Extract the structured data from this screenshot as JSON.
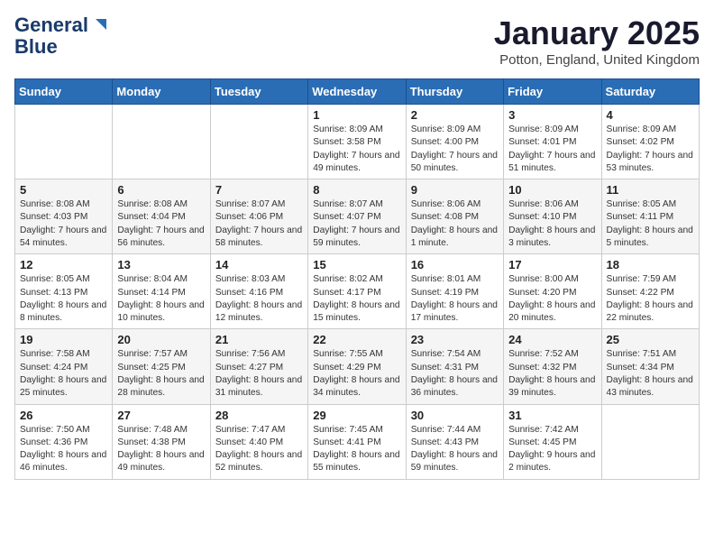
{
  "header": {
    "logo_line1": "General",
    "logo_line2": "Blue",
    "month": "January 2025",
    "location": "Potton, England, United Kingdom"
  },
  "weekdays": [
    "Sunday",
    "Monday",
    "Tuesday",
    "Wednesday",
    "Thursday",
    "Friday",
    "Saturday"
  ],
  "weeks": [
    [
      {
        "day": "",
        "sunrise": "",
        "sunset": "",
        "daylight": ""
      },
      {
        "day": "",
        "sunrise": "",
        "sunset": "",
        "daylight": ""
      },
      {
        "day": "",
        "sunrise": "",
        "sunset": "",
        "daylight": ""
      },
      {
        "day": "1",
        "sunrise": "Sunrise: 8:09 AM",
        "sunset": "Sunset: 3:58 PM",
        "daylight": "Daylight: 7 hours and 49 minutes."
      },
      {
        "day": "2",
        "sunrise": "Sunrise: 8:09 AM",
        "sunset": "Sunset: 4:00 PM",
        "daylight": "Daylight: 7 hours and 50 minutes."
      },
      {
        "day": "3",
        "sunrise": "Sunrise: 8:09 AM",
        "sunset": "Sunset: 4:01 PM",
        "daylight": "Daylight: 7 hours and 51 minutes."
      },
      {
        "day": "4",
        "sunrise": "Sunrise: 8:09 AM",
        "sunset": "Sunset: 4:02 PM",
        "daylight": "Daylight: 7 hours and 53 minutes."
      }
    ],
    [
      {
        "day": "5",
        "sunrise": "Sunrise: 8:08 AM",
        "sunset": "Sunset: 4:03 PM",
        "daylight": "Daylight: 7 hours and 54 minutes."
      },
      {
        "day": "6",
        "sunrise": "Sunrise: 8:08 AM",
        "sunset": "Sunset: 4:04 PM",
        "daylight": "Daylight: 7 hours and 56 minutes."
      },
      {
        "day": "7",
        "sunrise": "Sunrise: 8:07 AM",
        "sunset": "Sunset: 4:06 PM",
        "daylight": "Daylight: 7 hours and 58 minutes."
      },
      {
        "day": "8",
        "sunrise": "Sunrise: 8:07 AM",
        "sunset": "Sunset: 4:07 PM",
        "daylight": "Daylight: 7 hours and 59 minutes."
      },
      {
        "day": "9",
        "sunrise": "Sunrise: 8:06 AM",
        "sunset": "Sunset: 4:08 PM",
        "daylight": "Daylight: 8 hours and 1 minute."
      },
      {
        "day": "10",
        "sunrise": "Sunrise: 8:06 AM",
        "sunset": "Sunset: 4:10 PM",
        "daylight": "Daylight: 8 hours and 3 minutes."
      },
      {
        "day": "11",
        "sunrise": "Sunrise: 8:05 AM",
        "sunset": "Sunset: 4:11 PM",
        "daylight": "Daylight: 8 hours and 5 minutes."
      }
    ],
    [
      {
        "day": "12",
        "sunrise": "Sunrise: 8:05 AM",
        "sunset": "Sunset: 4:13 PM",
        "daylight": "Daylight: 8 hours and 8 minutes."
      },
      {
        "day": "13",
        "sunrise": "Sunrise: 8:04 AM",
        "sunset": "Sunset: 4:14 PM",
        "daylight": "Daylight: 8 hours and 10 minutes."
      },
      {
        "day": "14",
        "sunrise": "Sunrise: 8:03 AM",
        "sunset": "Sunset: 4:16 PM",
        "daylight": "Daylight: 8 hours and 12 minutes."
      },
      {
        "day": "15",
        "sunrise": "Sunrise: 8:02 AM",
        "sunset": "Sunset: 4:17 PM",
        "daylight": "Daylight: 8 hours and 15 minutes."
      },
      {
        "day": "16",
        "sunrise": "Sunrise: 8:01 AM",
        "sunset": "Sunset: 4:19 PM",
        "daylight": "Daylight: 8 hours and 17 minutes."
      },
      {
        "day": "17",
        "sunrise": "Sunrise: 8:00 AM",
        "sunset": "Sunset: 4:20 PM",
        "daylight": "Daylight: 8 hours and 20 minutes."
      },
      {
        "day": "18",
        "sunrise": "Sunrise: 7:59 AM",
        "sunset": "Sunset: 4:22 PM",
        "daylight": "Daylight: 8 hours and 22 minutes."
      }
    ],
    [
      {
        "day": "19",
        "sunrise": "Sunrise: 7:58 AM",
        "sunset": "Sunset: 4:24 PM",
        "daylight": "Daylight: 8 hours and 25 minutes."
      },
      {
        "day": "20",
        "sunrise": "Sunrise: 7:57 AM",
        "sunset": "Sunset: 4:25 PM",
        "daylight": "Daylight: 8 hours and 28 minutes."
      },
      {
        "day": "21",
        "sunrise": "Sunrise: 7:56 AM",
        "sunset": "Sunset: 4:27 PM",
        "daylight": "Daylight: 8 hours and 31 minutes."
      },
      {
        "day": "22",
        "sunrise": "Sunrise: 7:55 AM",
        "sunset": "Sunset: 4:29 PM",
        "daylight": "Daylight: 8 hours and 34 minutes."
      },
      {
        "day": "23",
        "sunrise": "Sunrise: 7:54 AM",
        "sunset": "Sunset: 4:31 PM",
        "daylight": "Daylight: 8 hours and 36 minutes."
      },
      {
        "day": "24",
        "sunrise": "Sunrise: 7:52 AM",
        "sunset": "Sunset: 4:32 PM",
        "daylight": "Daylight: 8 hours and 39 minutes."
      },
      {
        "day": "25",
        "sunrise": "Sunrise: 7:51 AM",
        "sunset": "Sunset: 4:34 PM",
        "daylight": "Daylight: 8 hours and 43 minutes."
      }
    ],
    [
      {
        "day": "26",
        "sunrise": "Sunrise: 7:50 AM",
        "sunset": "Sunset: 4:36 PM",
        "daylight": "Daylight: 8 hours and 46 minutes."
      },
      {
        "day": "27",
        "sunrise": "Sunrise: 7:48 AM",
        "sunset": "Sunset: 4:38 PM",
        "daylight": "Daylight: 8 hours and 49 minutes."
      },
      {
        "day": "28",
        "sunrise": "Sunrise: 7:47 AM",
        "sunset": "Sunset: 4:40 PM",
        "daylight": "Daylight: 8 hours and 52 minutes."
      },
      {
        "day": "29",
        "sunrise": "Sunrise: 7:45 AM",
        "sunset": "Sunset: 4:41 PM",
        "daylight": "Daylight: 8 hours and 55 minutes."
      },
      {
        "day": "30",
        "sunrise": "Sunrise: 7:44 AM",
        "sunset": "Sunset: 4:43 PM",
        "daylight": "Daylight: 8 hours and 59 minutes."
      },
      {
        "day": "31",
        "sunrise": "Sunrise: 7:42 AM",
        "sunset": "Sunset: 4:45 PM",
        "daylight": "Daylight: 9 hours and 2 minutes."
      },
      {
        "day": "",
        "sunrise": "",
        "sunset": "",
        "daylight": ""
      }
    ]
  ]
}
